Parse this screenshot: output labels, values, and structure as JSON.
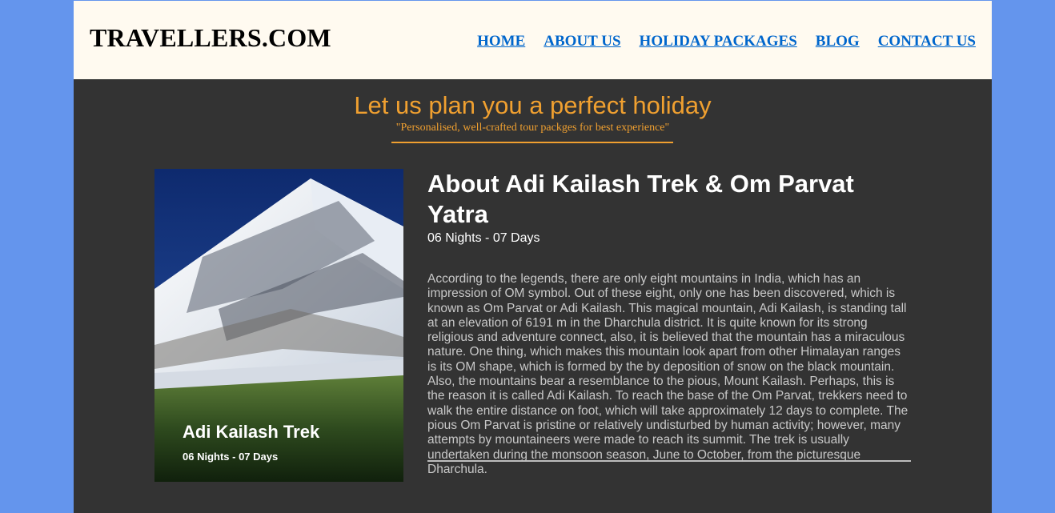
{
  "header": {
    "logo": "TRAVELLERS.COM",
    "nav": [
      "HOME",
      "ABOUT US",
      "HOLIDAY PACKAGES",
      "BLOG",
      "CONTACT US"
    ]
  },
  "hero": {
    "title": "Let us plan you a perfect holiday",
    "subtitle": "\"Personalised, well-crafted tour packges for best experience\""
  },
  "trek": {
    "image_title": "Adi Kailash Trek",
    "image_subtitle": "06 Nights - 07 Days",
    "title": "About Adi Kailash Trek & Om Parvat Yatra",
    "duration": "06 Nights - 07 Days",
    "description": "According to the legends, there are only eight mountains in India, which has an impression of OM symbol. Out of these eight, only one has been discovered, which is known as Om Parvat or Adi Kailash. This magical mountain, Adi Kailash, is standing tall at an elevation of 6191 m in the Dharchula district. It is quite known for its strong religious and adventure connect, also, it is believed that the mountain has a miraculous nature. One thing, which makes this mountain look apart from other Himalayan ranges is its OM shape, which is formed by the by deposition of snow on the black mountain. Also, the mountains bear a resemblance to the pious, Mount Kailash. Perhaps, this is the reason it is called Adi Kailash. To reach the base of the Om Parvat, trekkers need to walk the entire distance on foot, which will take approximately 12 days to complete. The pious Om Parvat is pristine or relatively undisturbed by human activity; however, many attempts by mountaineers were made to reach its summit. The trek is usually undertaken during the monsoon season, June to October, from the picturesque Dharchula."
  },
  "colors": {
    "page_background": "#6495ED",
    "header_background": "#FFFAF0",
    "content_background": "#333333",
    "accent": "#F0A030",
    "link": "#0066CC"
  }
}
